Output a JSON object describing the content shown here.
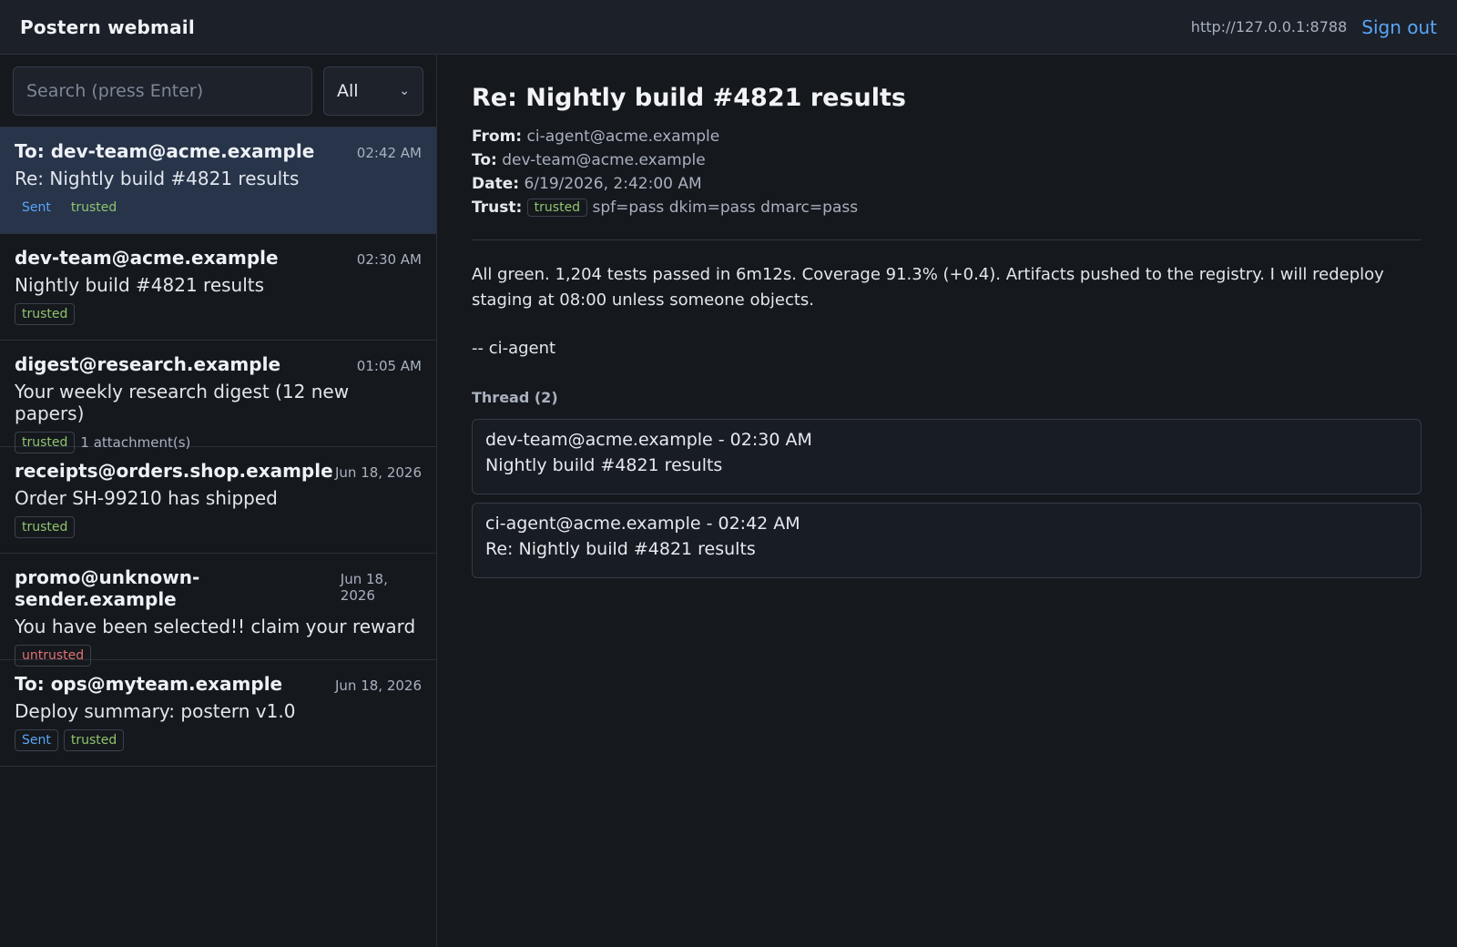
{
  "header": {
    "title": "Postern webmail",
    "server_url": "http://127.0.0.1:8788",
    "signout_label": "Sign out"
  },
  "search": {
    "placeholder": "Search (press Enter)",
    "filter_value": "All"
  },
  "messages": [
    {
      "from": "To: dev-team@acme.example",
      "time": "02:42 AM",
      "subject": "Re: Nightly build #4821 results",
      "tags": [
        "Sent",
        "trusted"
      ],
      "attachment": ""
    },
    {
      "from": "dev-team@acme.example",
      "time": "02:30 AM",
      "subject": "Nightly build #4821 results",
      "tags": [
        "trusted"
      ],
      "attachment": ""
    },
    {
      "from": "digest@research.example",
      "time": "01:05 AM",
      "subject": "Your weekly research digest (12 new papers)",
      "tags": [
        "trusted"
      ],
      "attachment": "1 attachment(s)"
    },
    {
      "from": "receipts@orders.shop.example",
      "time": "Jun 18, 2026",
      "subject": "Order SH-99210 has shipped",
      "tags": [
        "trusted"
      ],
      "attachment": ""
    },
    {
      "from": "promo@unknown-sender.example",
      "time": "Jun 18, 2026",
      "subject": "You have been selected!! claim your reward",
      "tags": [
        "untrusted"
      ],
      "attachment": ""
    },
    {
      "from": "To: ops@myteam.example",
      "time": "Jun 18, 2026",
      "subject": "Deploy summary: postern v1.0",
      "tags": [
        "Sent",
        "trusted"
      ],
      "attachment": ""
    }
  ],
  "reader": {
    "title": "Re: Nightly build #4821 results",
    "from_label": "From:",
    "from_value": "ci-agent@acme.example",
    "to_label": "To:",
    "to_value": "dev-team@acme.example",
    "date_label": "Date:",
    "date_value": "6/19/2026, 2:42:00 AM",
    "trust_label": "Trust:",
    "trust_tag": "trusted",
    "trust_auth": "spf=pass dkim=pass dmarc=pass",
    "body": "All green. 1,204 tests passed in 6m12s. Coverage 91.3% (+0.4). Artifacts pushed to the registry. I will redeploy staging at 08:00 unless someone objects.",
    "signature": "-- ci-agent",
    "thread_heading": "Thread (2)",
    "thread": [
      {
        "line1": "dev-team@acme.example - 02:30 AM",
        "line2": "Nightly build #4821 results"
      },
      {
        "line1": "ci-agent@acme.example - 02:42 AM",
        "line2": "Re: Nightly build #4821 results"
      }
    ]
  },
  "colors": {
    "accent": "#5aa5f6",
    "trusted": "#8fc46d",
    "untrusted": "#e07272",
    "selected_row": "#27344a"
  }
}
